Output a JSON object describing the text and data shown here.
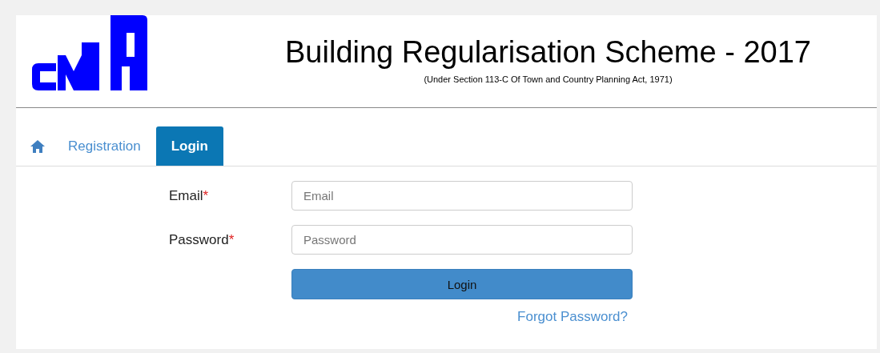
{
  "header": {
    "title": "Building Regularisation Scheme - 2017",
    "subtitle": "(Under Section 113-C Of Town and Country Planning Act, 1971)"
  },
  "tabs": [
    {
      "kind": "home",
      "selected": false
    },
    {
      "kind": "text",
      "label": "Registration",
      "selected": false
    },
    {
      "kind": "text",
      "label": "Login",
      "selected": true
    }
  ],
  "form": {
    "fields": [
      {
        "label": "Email",
        "required_mark": "*",
        "placeholder": "Email"
      },
      {
        "label": "Password",
        "required_mark": "*",
        "placeholder": "Password"
      }
    ],
    "submit": "Login",
    "forgot_link": "Forgot Password?"
  }
}
